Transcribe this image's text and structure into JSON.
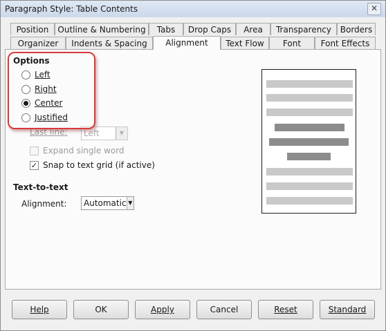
{
  "window": {
    "title": "Paragraph Style: Table Contents",
    "close_glyph": "✕"
  },
  "tabs_row1": [
    {
      "label": "Position"
    },
    {
      "label": "Outline & Numbering"
    },
    {
      "label": "Tabs"
    },
    {
      "label": "Drop Caps"
    },
    {
      "label": "Area"
    },
    {
      "label": "Transparency"
    },
    {
      "label": "Borders"
    }
  ],
  "tabs_row2": [
    {
      "label": "Organizer"
    },
    {
      "label": "Indents & Spacing"
    },
    {
      "label": "Alignment",
      "active": true
    },
    {
      "label": "Text Flow"
    },
    {
      "label": "Font"
    },
    {
      "label": "Font Effects"
    }
  ],
  "options": {
    "heading": "Options",
    "radios": [
      {
        "label": "Left",
        "checked": false
      },
      {
        "label": "Right",
        "checked": false
      },
      {
        "label": "Center",
        "checked": true
      },
      {
        "label": "Justified",
        "checked": false
      }
    ],
    "last_line_label": "Last line:",
    "last_line_value": "Left",
    "expand_single_word": {
      "label": "Expand single word",
      "checked": false,
      "enabled": false
    },
    "snap_to_grid": {
      "label": "Snap to text grid (if active)",
      "checked": true,
      "enabled": true
    }
  },
  "text_to_text": {
    "heading": "Text-to-text",
    "alignment_label": "Alignment:",
    "alignment_value": "Automatic"
  },
  "buttons": {
    "help": "Help",
    "ok": "OK",
    "apply": "Apply",
    "cancel": "Cancel",
    "reset": "Reset",
    "standard": "Standard"
  },
  "colors": {
    "highlight": "#d83a3a",
    "preview_line": "#c9c9c9",
    "preview_centered_line": "#8c8c8c"
  }
}
